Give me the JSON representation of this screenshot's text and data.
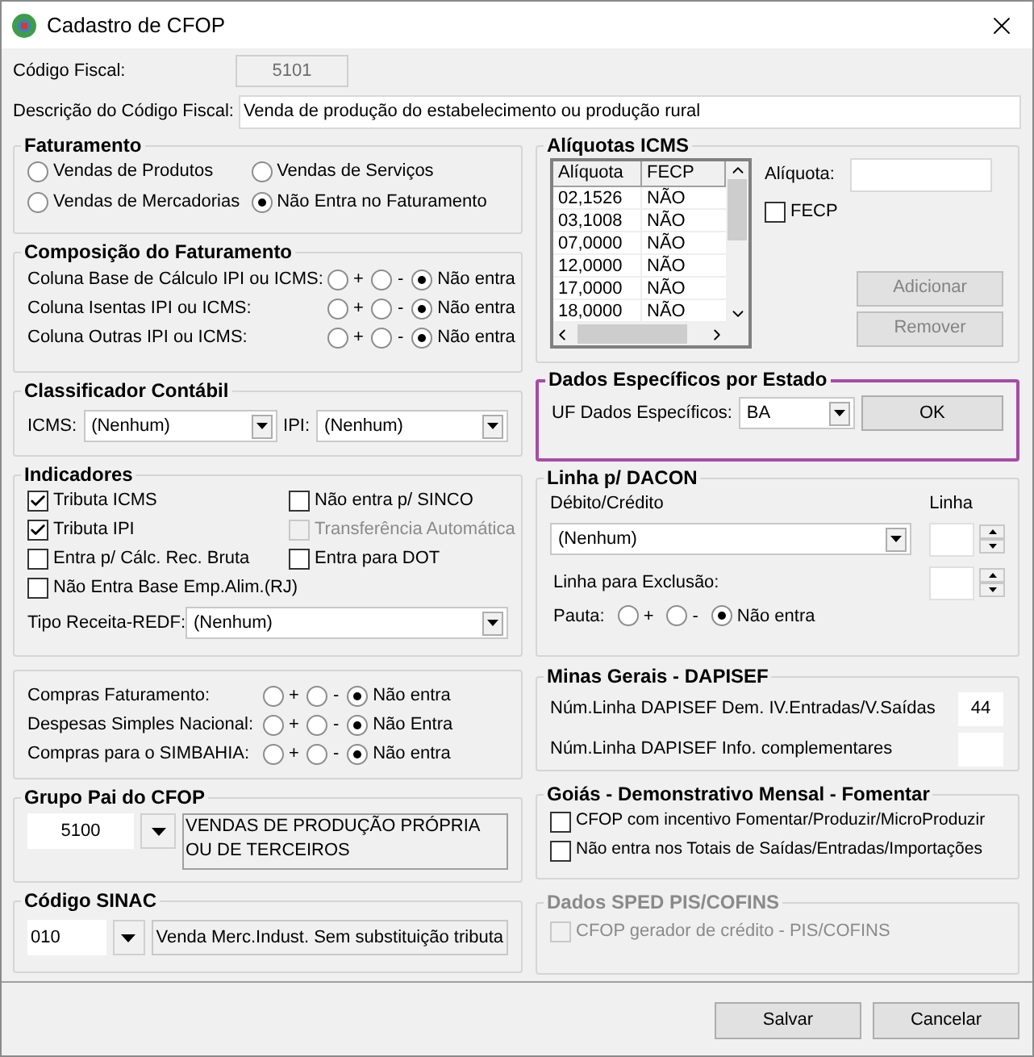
{
  "window": {
    "title": "Cadastro de CFOP"
  },
  "codigo_fiscal": {
    "label": "Código Fiscal:",
    "value": "5101",
    "disabled": true
  },
  "descricao": {
    "label": "Descrição do Código Fiscal:",
    "value": "Venda de produção do estabelecimento ou produção rural"
  },
  "faturamento": {
    "title": "Faturamento",
    "options": [
      {
        "label": "Vendas de Produtos",
        "selected": false
      },
      {
        "label": "Vendas de Serviços",
        "selected": false
      },
      {
        "label": "Vendas de Mercadorias",
        "selected": false
      },
      {
        "label": "Não Entra no Faturamento",
        "selected": true
      }
    ]
  },
  "composicao": {
    "title": "Composição do Faturamento",
    "rows": [
      {
        "label": "Coluna Base de Cálculo IPI ou ICMS:",
        "options": [
          {
            "label": "+",
            "selected": false
          },
          {
            "label": "-",
            "selected": false
          },
          {
            "label": "Não entra",
            "selected": true
          }
        ]
      },
      {
        "label": "Coluna Isentas IPI ou ICMS:",
        "options": [
          {
            "label": "+",
            "selected": false
          },
          {
            "label": "-",
            "selected": false
          },
          {
            "label": "Não entra",
            "selected": true
          }
        ]
      },
      {
        "label": "Coluna Outras IPI ou ICMS:",
        "options": [
          {
            "label": "+",
            "selected": false
          },
          {
            "label": "-",
            "selected": false
          },
          {
            "label": "Não entra",
            "selected": true
          }
        ]
      }
    ]
  },
  "classificador": {
    "title": "Classificador Contábil",
    "fields": [
      {
        "label": "ICMS:",
        "value": "(Nenhum)"
      },
      {
        "label": "IPI:",
        "value": "(Nenhum)"
      }
    ]
  },
  "indicadores": {
    "title": "Indicadores",
    "checkboxes": [
      {
        "label": "Tributa ICMS",
        "checked": true,
        "disabled": false
      },
      {
        "label": "Não entra p/ SINCO",
        "checked": false,
        "disabled": false
      },
      {
        "label": "Tributa IPI",
        "checked": true,
        "disabled": false
      },
      {
        "label": "Transferência Automática",
        "checked": false,
        "disabled": true
      },
      {
        "label": "Entra p/ Cálc. Rec. Bruta",
        "checked": false,
        "disabled": false
      },
      {
        "label": "Entra para DOT",
        "checked": false,
        "disabled": false
      },
      {
        "label": "Não Entra Base Emp.Alim.(RJ)",
        "checked": false,
        "disabled": false
      }
    ],
    "tipo_receita": {
      "label": "Tipo Receita-REDF:",
      "value": "(Nenhum)"
    }
  },
  "compras": {
    "rows": [
      {
        "label": "Compras Faturamento:",
        "options": [
          {
            "label": "+",
            "selected": false
          },
          {
            "label": "-",
            "selected": false
          },
          {
            "label": "Não entra",
            "selected": true
          }
        ]
      },
      {
        "label": "Despesas Simples Nacional:",
        "options": [
          {
            "label": "+",
            "selected": false
          },
          {
            "label": "-",
            "selected": false
          },
          {
            "label": "Não Entra",
            "selected": true
          }
        ]
      },
      {
        "label": "Compras para o SIMBAHIA:",
        "options": [
          {
            "label": "+",
            "selected": false
          },
          {
            "label": "-",
            "selected": false
          },
          {
            "label": "Não entra",
            "selected": true
          }
        ]
      }
    ]
  },
  "grupo_pai": {
    "title": "Grupo Pai do CFOP",
    "code": "5100",
    "description": "VENDAS DE PRODUÇÃO PRÓPRIA OU DE TERCEIROS"
  },
  "codigo_sinac": {
    "title": "Código SINAC",
    "code": "010",
    "description": "Venda Merc.Indust. Sem substituição tributa"
  },
  "aliquotas": {
    "title": "Alíquotas ICMS",
    "columns": [
      "Alíquota",
      "FECP"
    ],
    "rows": [
      [
        "02,1526",
        "NÃO"
      ],
      [
        "03,1008",
        "NÃO"
      ],
      [
        "07,0000",
        "NÃO"
      ],
      [
        "12,0000",
        "NÃO"
      ],
      [
        "17,0000",
        "NÃO"
      ],
      [
        "18,0000",
        "NÃO"
      ]
    ],
    "field_label": "Alíquota:",
    "fecp": {
      "label": "FECP",
      "checked": false
    },
    "buttons": [
      {
        "label": "Adicionar",
        "disabled": true
      },
      {
        "label": "Remover",
        "disabled": true
      }
    ]
  },
  "dados_estado": {
    "title": "Dados Específicos por Estado",
    "highlighted": true,
    "label": "UF Dados Específicos:",
    "value": "BA",
    "button": "OK"
  },
  "dacon": {
    "title": "Linha p/ DACON",
    "debito_label": "Débito/Crédito",
    "debito_value": "(Nenhum)",
    "linha_label": "Linha",
    "exclusao_label": "Linha para Exclusão:",
    "pauta": {
      "label": "Pauta:",
      "options": [
        {
          "label": "+",
          "selected": false
        },
        {
          "label": "-",
          "selected": false
        },
        {
          "label": "Não entra",
          "selected": true
        }
      ]
    }
  },
  "minas": {
    "title": "Minas Gerais - DAPISEF",
    "fields": [
      {
        "label": "Núm.Linha DAPISEF Dem. IV.Entradas/V.Saídas",
        "value": "44"
      },
      {
        "label": "Núm.Linha DAPISEF Info. complementares"
      }
    ]
  },
  "goias": {
    "title": "Goiás - Demonstrativo Mensal - Fomentar",
    "checkboxes": [
      {
        "label": "CFOP com incentivo  Fomentar/Produzir/MicroProduzir",
        "checked": false,
        "disabled": false
      },
      {
        "label": "Não entra nos Totais de  Saídas/Entradas/Importações",
        "checked": false,
        "disabled": false
      }
    ]
  },
  "sped": {
    "title": "Dados SPED PIS/COFINS",
    "disabled": true,
    "checkboxes": [
      {
        "label": "CFOP gerador de crédito - PIS/COFINS",
        "checked": false,
        "disabled": true
      }
    ]
  },
  "footer_buttons": [
    {
      "label": "Salvar"
    },
    {
      "label": "Cancelar"
    }
  ]
}
